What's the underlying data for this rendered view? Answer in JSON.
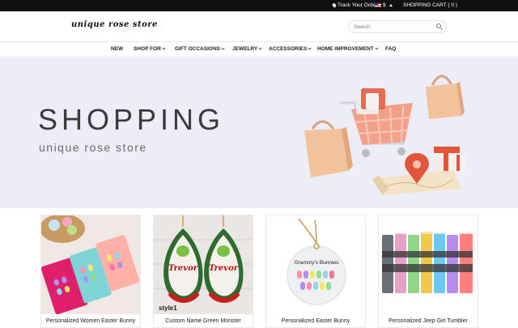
{
  "topbar": {
    "track_label": "Track Your Order",
    "currency": "$",
    "cart_label": "SHOPPING CART ( 0 )"
  },
  "header": {
    "logo_text": "unique rose store",
    "search_placeholder": "Search"
  },
  "nav": {
    "items": [
      {
        "label": "NEW",
        "dropdown": false
      },
      {
        "label": "SHOP FOR",
        "dropdown": true
      },
      {
        "label": "GIFT OCCASIONS",
        "dropdown": true
      },
      {
        "label": "JEWELRY",
        "dropdown": true
      },
      {
        "label": "ACCESSORIES",
        "dropdown": true
      },
      {
        "label": "HOME IMPROVEMENT",
        "dropdown": true
      },
      {
        "label": "FAQ",
        "dropdown": false
      }
    ]
  },
  "hero": {
    "title": "SHOPPING",
    "subtitle": "unique rose store"
  },
  "products": [
    {
      "name": "Personalized Women Easter Bunny"
    },
    {
      "name": "Custom Name Green Monster",
      "image_text": "Trevor",
      "tag_text": "style1"
    },
    {
      "name": "Personalized Easter Bunny",
      "image_text": "Grammy's Bunnies"
    },
    {
      "name": "Personalized Jeep Girl Tumbler"
    }
  ],
  "colors": {
    "topbar_bg": "#111111",
    "hero_bg": "#ecedf7",
    "accent_coral": "#f2a08a",
    "accent_red": "#e2553a"
  }
}
